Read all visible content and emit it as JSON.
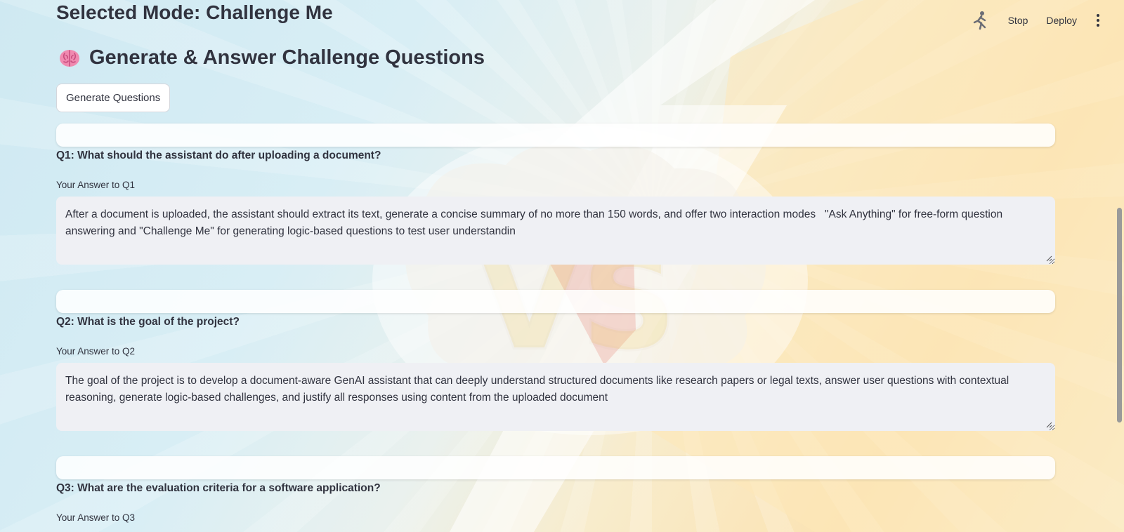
{
  "header": {
    "stop_label": "Stop",
    "deploy_label": "Deploy",
    "running_icon": "running-man-icon",
    "menu_icon": "kebab-menu-icon"
  },
  "main": {
    "mode_title": "Selected Mode: Challenge Me",
    "section_icon": "brain-icon",
    "section_title": "Generate & Answer Challenge Questions",
    "generate_button": "Generate Questions"
  },
  "questions": [
    {
      "question": "Q1: What should the assistant do after uploading a document?",
      "answer_label": "Your Answer to Q1",
      "answer": "After a document is uploaded, the assistant should extract its text, generate a concise summary of no more than 150 words, and offer two interaction modes   \"Ask Anything\" for free-form question answering and \"Challenge Me\" for generating logic-based questions to test user understandin"
    },
    {
      "question": "Q2: What is the goal of the project?",
      "answer_label": "Your Answer to Q2",
      "answer": "The goal of the project is to develop a document-aware GenAI assistant that can deeply understand structured documents like research papers or legal texts, answer user questions with contextual reasoning, generate logic-based challenges, and justify all responses using content from the uploaded document"
    },
    {
      "question": "Q3: What are the evaluation criteria for a software application?",
      "answer_label": "Your Answer to Q3",
      "answer": ""
    }
  ],
  "colors": {
    "text": "#31333f",
    "input_bg": "#eff0f4",
    "bg_blue": "#cfe9f2",
    "bg_yellow": "#fbe3b3"
  }
}
